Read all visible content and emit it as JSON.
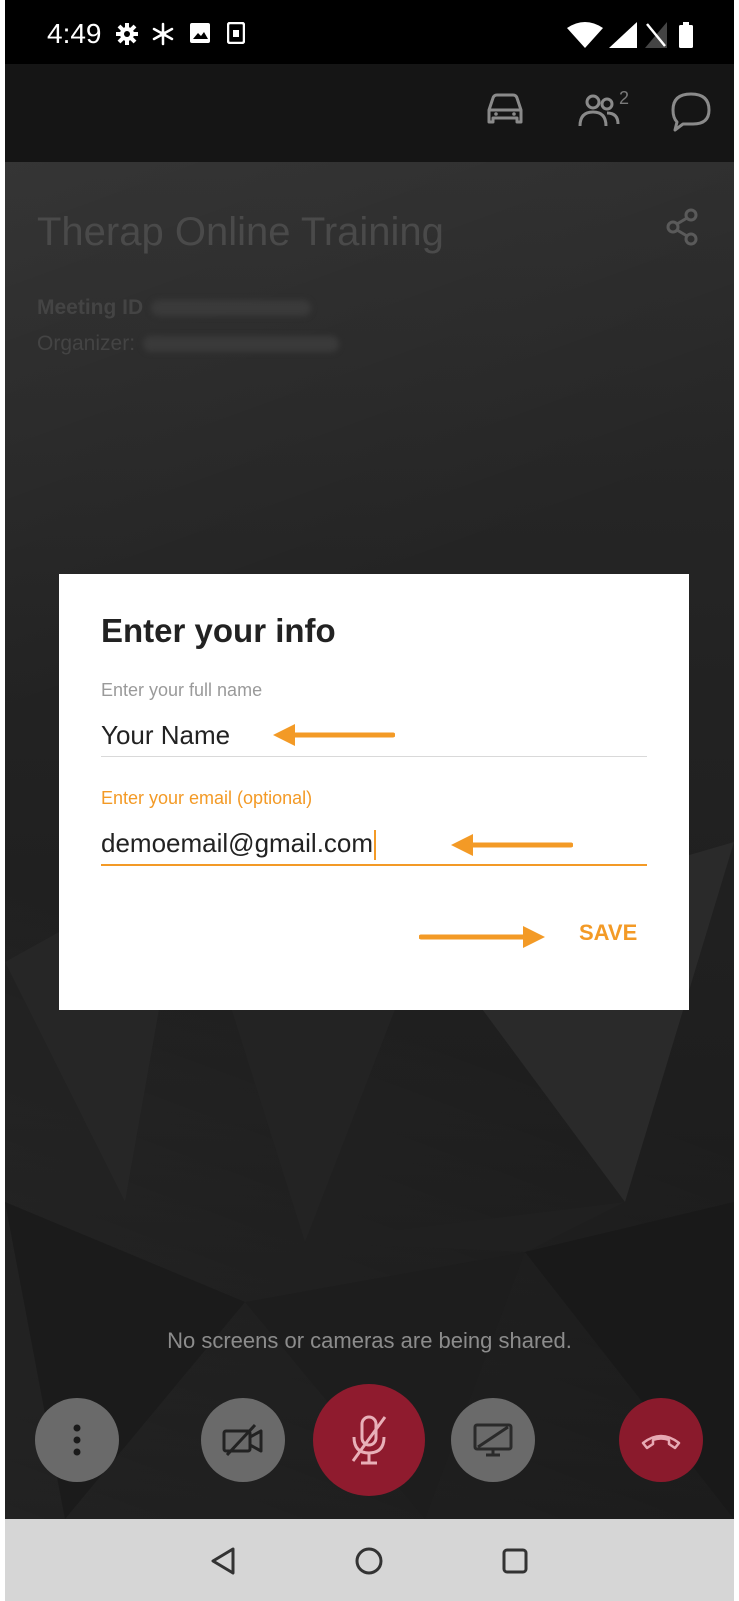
{
  "status_bar": {
    "time": "4:49",
    "icons": [
      "settings-icon",
      "snowflake-icon",
      "image-icon",
      "sim-icon",
      "wifi-icon",
      "signal-icon",
      "no-sim-icon",
      "battery-icon"
    ]
  },
  "app_bar": {
    "icons": [
      "car-mode-icon",
      "participants-icon",
      "chat-icon"
    ],
    "participants_count": "2"
  },
  "meeting": {
    "title": "Therap Online Training",
    "meeting_id_label": "Meeting ID",
    "organizer_label": "Organizer:"
  },
  "dialog": {
    "title": "Enter your info",
    "name_field": {
      "label": "Enter your full name",
      "value": "Your Name"
    },
    "email_field": {
      "label": "Enter your email (optional)",
      "value": "demoemail@gmail.com"
    },
    "save_label": "SAVE"
  },
  "stage": {
    "no_share_text": "No screens or cameras are being shared."
  },
  "controls": [
    "more-options-icon",
    "camera-off-icon",
    "mic-muted-icon",
    "screen-share-off-icon",
    "end-call-icon"
  ],
  "nav_bar": [
    "back-icon",
    "home-icon",
    "recents-icon"
  ],
  "colors": {
    "accent": "#f39a26",
    "mute_red": "#8f1b2e",
    "end_call_red": "#8a1a2c",
    "control_gray": "#6a6a6a"
  }
}
